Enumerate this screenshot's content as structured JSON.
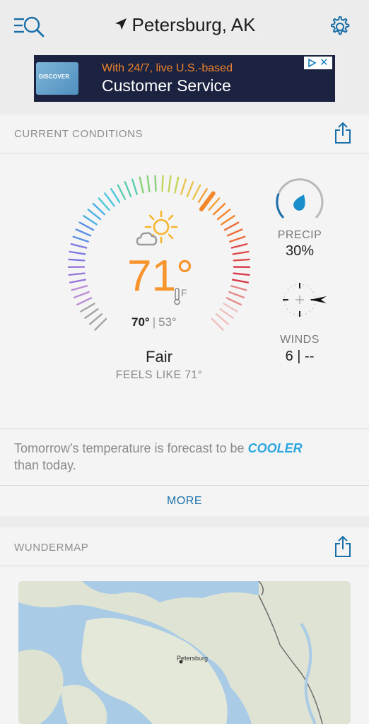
{
  "header": {
    "location": "Petersburg, AK",
    "search_icon": "search-menu-icon",
    "location_icon": "location-arrow-icon",
    "settings_icon": "gear-icon"
  },
  "ad": {
    "brand": "DISCOVER",
    "line1": "With 24/7, live U.S.-based",
    "line2": "Customer Service",
    "close": "✕"
  },
  "current_conditions": {
    "section_title": "CURRENT CONDITIONS",
    "temperature": "71°",
    "unit": "F",
    "high": "70°",
    "low": "53°",
    "separator": "|",
    "condition": "Fair",
    "feels_like": "FEELS LIKE 71°",
    "precip_label": "PRECIP",
    "precip_value": "30%",
    "winds_label": "WINDS",
    "winds_value": "6 | --",
    "forecast_prefix": "Tomorrow's temperature is forecast to be ",
    "forecast_emphasis": "COOLER",
    "forecast_suffix": "than today.",
    "more_label": "MORE"
  },
  "wundermap": {
    "section_title": "WUNDERMAP",
    "map_label": "Petersburg"
  },
  "colors": {
    "accent": "#1a6fa8",
    "temp": "#f7942c",
    "cooler": "#2ba6de",
    "ad_bg": "#1b2340",
    "ad_orange": "#f0822a"
  }
}
